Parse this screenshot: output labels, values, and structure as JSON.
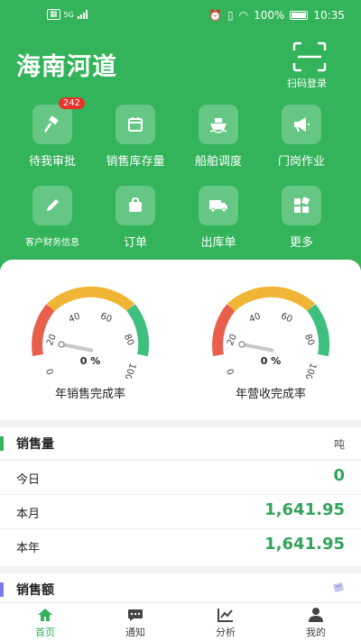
{
  "status": {
    "network": "5G",
    "battery": "100%",
    "time": "10:35"
  },
  "header": {
    "title": "海南河道",
    "scan_label": "扫码登录"
  },
  "grid": [
    {
      "label": "待我审批",
      "icon": "gavel-icon",
      "badge": "242"
    },
    {
      "label": "销售库存量",
      "icon": "calendar-icon"
    },
    {
      "label": "船舶调度",
      "icon": "ship-icon"
    },
    {
      "label": "门岗作业",
      "icon": "megaphone-icon"
    },
    {
      "label": "客户财务信息",
      "icon": "pencil-icon"
    },
    {
      "label": "订单",
      "icon": "bag-icon"
    },
    {
      "label": "出库单",
      "icon": "truck-icon"
    },
    {
      "label": "更多",
      "icon": "more-icon"
    }
  ],
  "gauges": [
    {
      "label": "年销售完成率",
      "value": 0,
      "value_text": "0 %",
      "ticks": [
        "0",
        "20",
        "40",
        "60",
        "80",
        "100"
      ]
    },
    {
      "label": "年营收完成率",
      "value": 0,
      "value_text": "0 %",
      "ticks": [
        "0",
        "20",
        "40",
        "60",
        "80",
        "100"
      ]
    }
  ],
  "sales_volume": {
    "title": "销售量",
    "unit": "吨",
    "rows": [
      {
        "label": "今日",
        "value": "0"
      },
      {
        "label": "本月",
        "value": "1,641.95"
      },
      {
        "label": "本年",
        "value": "1,641.95"
      }
    ]
  },
  "sales_amount": {
    "title": "销售额"
  },
  "tabs": [
    {
      "label": "首页",
      "icon": "home-icon",
      "active": true
    },
    {
      "label": "通知",
      "icon": "chat-icon"
    },
    {
      "label": "分析",
      "icon": "chart-icon"
    },
    {
      "label": "我的",
      "icon": "user-icon"
    }
  ],
  "colors": {
    "primary": "#33b35a",
    "gauge_red": "#e8604c",
    "gauge_yellow": "#f0b534",
    "gauge_green": "#3fbf7f",
    "badge": "#e8302c"
  }
}
